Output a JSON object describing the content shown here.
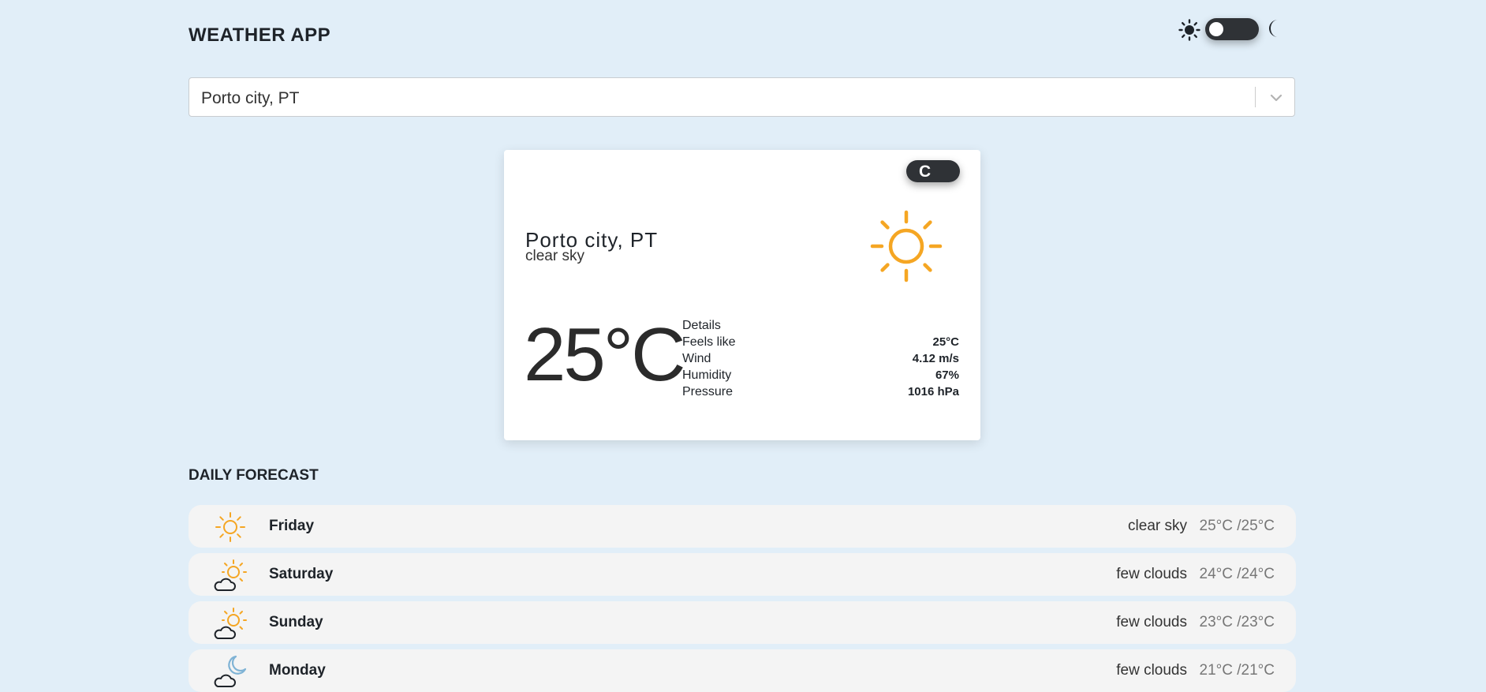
{
  "header": {
    "title": "WEATHER APP",
    "theme_toggle": {
      "light_icon": "sun-icon",
      "dark_icon": "moon-icon",
      "mode": "light"
    }
  },
  "search": {
    "selected_city": "Porto city, PT",
    "dropdown_icon": "chevron-down-icon"
  },
  "current": {
    "unit_label": "C",
    "city": "Porto city, PT",
    "description": "clear sky",
    "icon": "sun-icon",
    "temperature": "25°C",
    "details_title": "Details",
    "details": [
      {
        "label": "Feels like",
        "value": "25°C"
      },
      {
        "label": "Wind",
        "value": "4.12 m/s"
      },
      {
        "label": "Humidity",
        "value": "67%"
      },
      {
        "label": "Pressure",
        "value": "1016 hPa"
      }
    ]
  },
  "forecast": {
    "title": "DAILY FORECAST",
    "days": [
      {
        "day": "Friday",
        "description": "clear sky",
        "range": "25°C /25°C",
        "icon": "sun-icon"
      },
      {
        "day": "Saturday",
        "description": "few clouds",
        "range": "24°C /24°C",
        "icon": "sun-cloud-icon"
      },
      {
        "day": "Sunday",
        "description": "few clouds",
        "range": "23°C /23°C",
        "icon": "sun-cloud-icon"
      },
      {
        "day": "Monday",
        "description": "few clouds",
        "range": "21°C /21°C",
        "icon": "moon-cloud-icon"
      }
    ]
  },
  "colors": {
    "background": "#e1eef8",
    "sun": "#f5a623",
    "toggle": "#2f3236",
    "row": "#f4f4f4",
    "moon": "#7fb3d5"
  }
}
